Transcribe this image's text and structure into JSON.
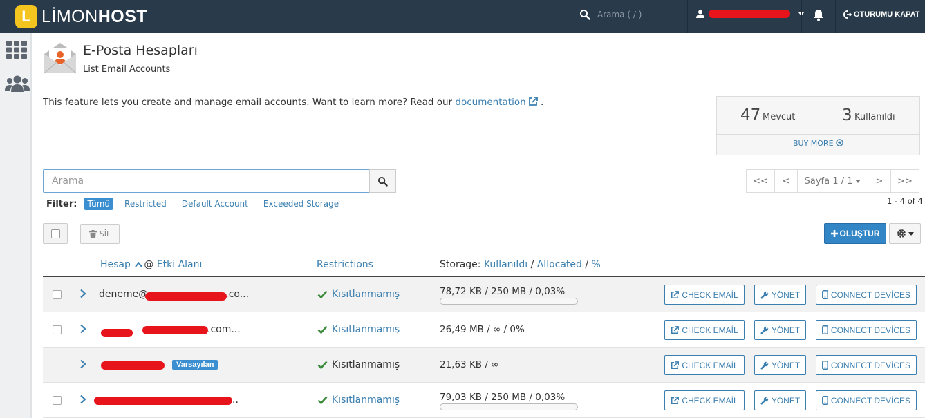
{
  "brand": {
    "logo_letter": "L",
    "name_light": "LİMON",
    "name_bold": "HOST",
    "accent": "#f4c51e"
  },
  "topbar": {
    "search_placeholder": "Arama ( / )",
    "logout_label": "OTURUMU KAPAT",
    "bg": "#293a4a"
  },
  "page": {
    "title": "E-Posta Hesapları",
    "subtitle": "List Email Accounts",
    "description": "This feature lets you create and manage email accounts. Want to learn more? Read our",
    "doc_link": "documentation",
    "desc_end": "."
  },
  "quota": {
    "available_num": "47",
    "available_label": "Mevcut",
    "used_num": "3",
    "used_label": "Kullanıldı",
    "buy_more": "BUY MORE"
  },
  "search": {
    "placeholder": "Arama"
  },
  "pager": {
    "first": "<<",
    "prev": "<",
    "page_label": "Sayfa 1 / 1",
    "next": ">",
    "last": ">>",
    "count": "1 - 4 of 4"
  },
  "filter": {
    "label": "Filter:",
    "options": [
      "Tümü",
      "Restricted",
      "Default Account",
      "Exceeded Storage"
    ],
    "active": "Tümü"
  },
  "toolbar": {
    "delete_label": "SİL",
    "create_label": "OLUŞTUR"
  },
  "table": {
    "col_account": "Hesap",
    "col_at": "@",
    "col_domain": "Etki Alanı",
    "col_restrictions": "Restrictions",
    "col_storage_prefix": "Storage:",
    "col_used": "Kullanıldı",
    "col_sep1": "/",
    "col_allocated": "Allocated",
    "col_sep2": "/",
    "col_pct": "%",
    "rows": [
      {
        "account_visible": "deneme@",
        "account_tail": ".co...",
        "restriction": "Kısıtlanmamış",
        "storage": "78,72 KB / 250 MB / 0,03%",
        "usage_pct": 0.03,
        "has_checkbox": true,
        "is_default": false,
        "badge": ""
      },
      {
        "account_visible": "",
        "account_tail": ".com...",
        "restriction": "Kısıtlanmamış",
        "storage": "26,49 MB / ∞ / 0%",
        "usage_pct": 0,
        "has_checkbox": true,
        "is_default": false,
        "badge": ""
      },
      {
        "account_visible": "",
        "account_tail": "",
        "restriction": "Kısıtlanmamış",
        "storage": "21,63 KB / ∞",
        "usage_pct": null,
        "has_checkbox": false,
        "is_default": true,
        "badge": "Varsayılan"
      },
      {
        "account_visible": "",
        "account_tail": "..",
        "restriction": "Kısıtlanmamış",
        "storage": "79,03 KB / 250 MB / 0,03%",
        "usage_pct": 0.03,
        "has_checkbox": true,
        "is_default": false,
        "badge": ""
      }
    ],
    "actions": {
      "check_email": "CHECK EMAİL",
      "manage": "YÖNET",
      "connect": "CONNECT DEVİCES"
    }
  },
  "colors": {
    "link": "#3b7fb0",
    "primary": "#3286c5",
    "check_green": "#3c8a3c",
    "redaction": "#e8141c"
  }
}
